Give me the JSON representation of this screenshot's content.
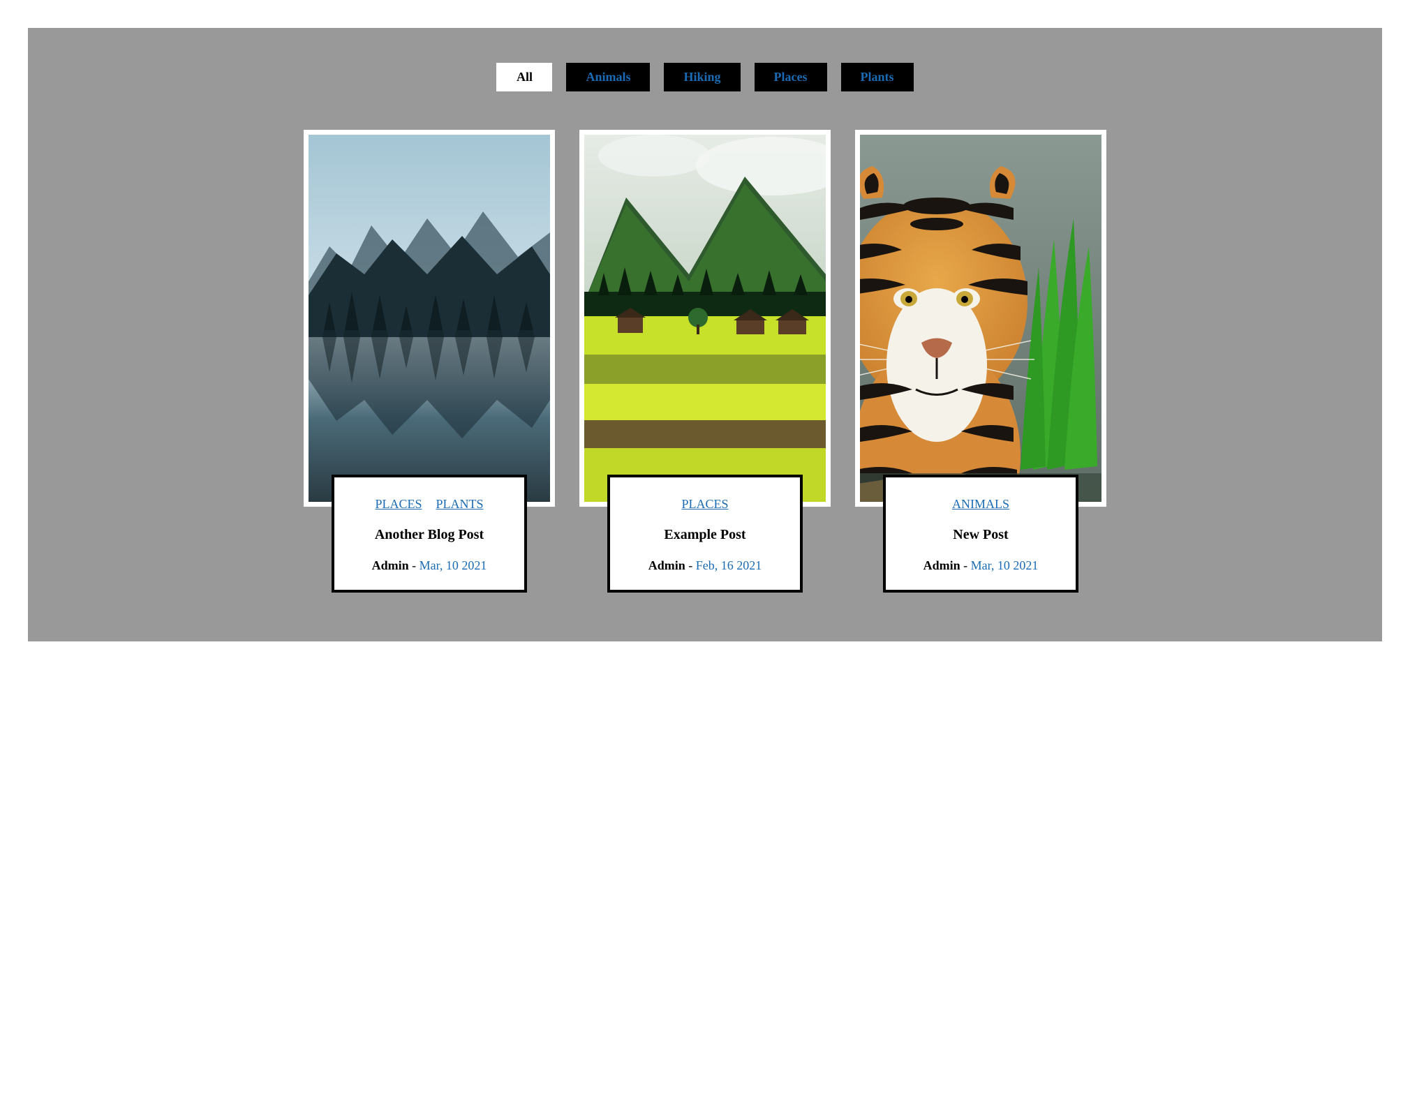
{
  "filters": [
    {
      "label": "All",
      "active": true
    },
    {
      "label": "Animals",
      "active": false
    },
    {
      "label": "Hiking",
      "active": false
    },
    {
      "label": "Places",
      "active": false
    },
    {
      "label": "Plants",
      "active": false
    }
  ],
  "posts": [
    {
      "categories": [
        "PLACES",
        "PLANTS"
      ],
      "title": "Another Blog Post",
      "author": "Admin",
      "date": "Mar, 10 2021"
    },
    {
      "categories": [
        "PLACES"
      ],
      "title": "Example Post",
      "author": "Admin",
      "date": "Feb, 16 2021"
    },
    {
      "categories": [
        "ANIMALS"
      ],
      "title": "New Post",
      "author": "Admin",
      "date": "Mar, 10 2021"
    }
  ]
}
